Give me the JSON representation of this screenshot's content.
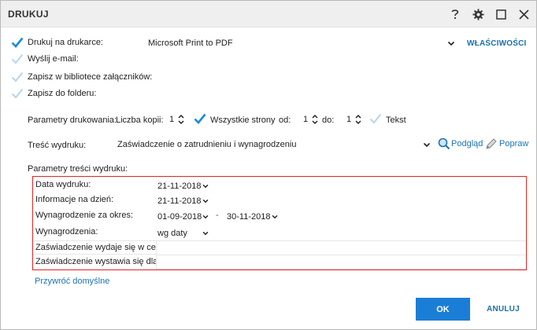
{
  "window": {
    "title": "DRUKUJ"
  },
  "options": {
    "print_on_printer": "Drukuj na drukarce:",
    "send_email": "Wyślij e-mail:",
    "save_attachments": "Zapisz w bibliotece załączników:",
    "save_folder": "Zapisz do folderu:"
  },
  "printer": {
    "selected": "Microsoft Print to PDF",
    "properties_label": "WŁAŚCIWOŚCI"
  },
  "print_params": {
    "label": "Parametry drukowania:",
    "copies_label": "Liczba kopii:",
    "copies_value": "1",
    "all_pages_label": "Wszystkie strony",
    "from_label": "od:",
    "from_value": "1",
    "to_label": "do:",
    "to_value": "1",
    "text_label": "Tekst"
  },
  "content": {
    "label": "Treść wydruku:",
    "selected": "Zaświadczenie o zatrudnieniu i wynagrodzeniu",
    "preview_label": "Podgląd",
    "edit_label": "Popraw"
  },
  "content_params": {
    "label": "Parametry treści wydruku:",
    "rows": {
      "print_date": {
        "label": "Data wydruku:",
        "value": "21-11-2018"
      },
      "info_date": {
        "label": "Informacje na dzień:",
        "value": "21-11-2018"
      },
      "salary_period": {
        "label": "Wynagrodzenie za okres:",
        "from": "01-09-2018",
        "dash": "-",
        "to": "30-11-2018"
      },
      "salaries": {
        "label": "Wynagrodzenia:",
        "value": "wg daty"
      },
      "purpose": {
        "label": "Zaświadczenie wydaje się w celu:",
        "value": ""
      },
      "issued_for": {
        "label": "Zaświadczenie wystawia się dla:",
        "value": ""
      }
    },
    "restore_defaults": "Przywróć domyślne"
  },
  "buttons": {
    "ok": "OK",
    "cancel": "ANULUJ"
  },
  "colors": {
    "accent": "#1b7ed6",
    "link": "#1a6fb0",
    "check_active": "#1a8be0",
    "check_inactive": "#b7d4ee",
    "highlight_border": "#e02424"
  }
}
